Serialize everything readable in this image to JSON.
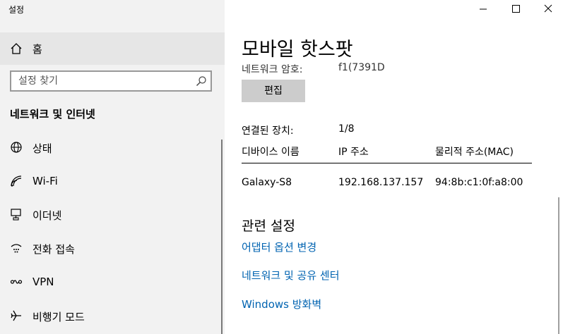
{
  "window": {
    "title": "설정",
    "controls": {
      "minimize_icon": "minimize-icon",
      "maximize_icon": "maximize-icon",
      "close_icon": "close-icon"
    }
  },
  "sidebar": {
    "home_label": "홈",
    "search_placeholder": "설정 찾기",
    "section_title": "네트워크 및 인터넷",
    "items": [
      {
        "label": "상태",
        "icon": "globe-icon"
      },
      {
        "label": "Wi-Fi",
        "icon": "wifi-icon"
      },
      {
        "label": "이더넷",
        "icon": "ethernet-icon"
      },
      {
        "label": "전화 접속",
        "icon": "dialup-icon"
      },
      {
        "label": "VPN",
        "icon": "vpn-icon"
      },
      {
        "label": "비행기 모드",
        "icon": "airplane-icon"
      }
    ]
  },
  "main": {
    "title": "모바일 핫스팟",
    "password_label": "네트워크 암호:",
    "password_value": "f1(7391D",
    "edit_button": "편집",
    "connected_label": "연결된 장치:",
    "connected_value": "1/8",
    "table": {
      "headers": [
        "디바이스 이름",
        "IP 주소",
        "물리적 주소(MAC)"
      ],
      "rows": [
        [
          "Galaxy-S8",
          "192.168.137.157",
          "94:8b:c1:0f:a8:00"
        ]
      ]
    },
    "related_title": "관련 설정",
    "links": [
      "어댑터 옵션 변경",
      "네트워크 및 공유 센터",
      "Windows 방화벽"
    ]
  },
  "colors": {
    "sidebar_bg": "#f2f2f2",
    "selected_bg": "#e6e6e6",
    "link": "#0063b1",
    "button_bg": "#cccccc"
  }
}
